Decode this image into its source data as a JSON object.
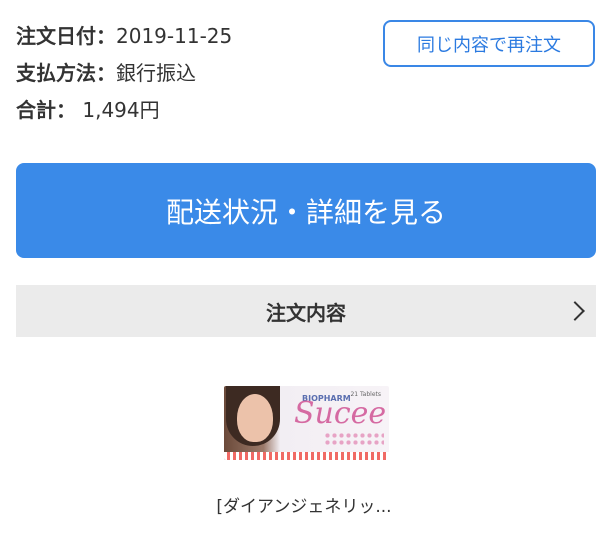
{
  "order": {
    "date_label": "注文日付：",
    "date_value": "2019-11-25",
    "payment_label": "支払方法：",
    "payment_value": "銀行振込",
    "total_label": "合計：",
    "total_value": " 1,494円"
  },
  "reorder_button": "同じ内容で再注文",
  "details_button": "配送状況・詳細を見る",
  "section": {
    "title": "注文内容"
  },
  "product": {
    "brand": "BIOPHARM",
    "logo": "Sucee",
    "tablets": "21 Tablets",
    "name": "[ダイアンジェネリッ..."
  },
  "colors": {
    "accent": "#3a8ae8",
    "section_bg": "#ebebeb"
  }
}
